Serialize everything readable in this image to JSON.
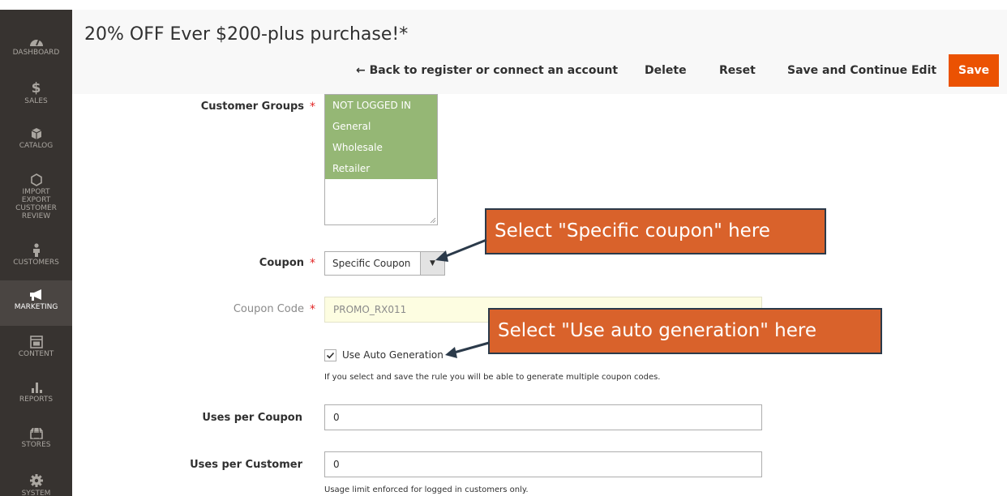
{
  "page": {
    "title": "20% OFF Ever $200-plus purchase!*"
  },
  "sidebar": {
    "items": [
      {
        "label": "DASHBOARD",
        "icon": "dashboard-icon"
      },
      {
        "label": "SALES",
        "icon": "dollar-icon"
      },
      {
        "label": "CATALOG",
        "icon": "box-icon"
      },
      {
        "label": "IMPORT EXPORT CUSTOMER REVIEW",
        "icon": "hexagon-icon"
      },
      {
        "label": "CUSTOMERS",
        "icon": "person-icon"
      },
      {
        "label": "MARKETING",
        "icon": "megaphone-icon",
        "active": true
      },
      {
        "label": "CONTENT",
        "icon": "layout-icon"
      },
      {
        "label": "REPORTS",
        "icon": "bar-chart-icon"
      },
      {
        "label": "STORES",
        "icon": "store-icon"
      },
      {
        "label": "SYSTEM",
        "icon": "gear-icon"
      }
    ]
  },
  "actions": {
    "back_label": "← Back to register or connect an account",
    "delete_label": "Delete",
    "reset_label": "Reset",
    "save_continue_label": "Save and Continue Edit",
    "save_label": "Save"
  },
  "form": {
    "customer_groups": {
      "label": "Customer Groups",
      "options": [
        "NOT LOGGED IN",
        "General",
        "Wholesale",
        "Retailer"
      ]
    },
    "coupon": {
      "label": "Coupon",
      "selected": "Specific Coupon"
    },
    "coupon_code": {
      "label": "Coupon Code",
      "value": "PROMO_RX011"
    },
    "auto_generation": {
      "label": "Use Auto Generation",
      "checked": true,
      "note": "If you select and save the rule you will be able to generate multiple coupon codes."
    },
    "uses_per_coupon": {
      "label": "Uses per Coupon",
      "value": "0"
    },
    "uses_per_customer": {
      "label": "Uses per Customer",
      "value": "0",
      "note": "Usage limit enforced for logged in customers only."
    },
    "required_mark": "*"
  },
  "callouts": {
    "specific_coupon": "Select \"Specific coupon\" here",
    "auto_generation": "Select \"Use auto generation\" here"
  },
  "colors": {
    "accent": "#eb5202",
    "sidebar_bg": "#373330",
    "selected_option": "#95b775",
    "callout_bg": "#d9622b",
    "callout_border": "#2b3a4a"
  }
}
